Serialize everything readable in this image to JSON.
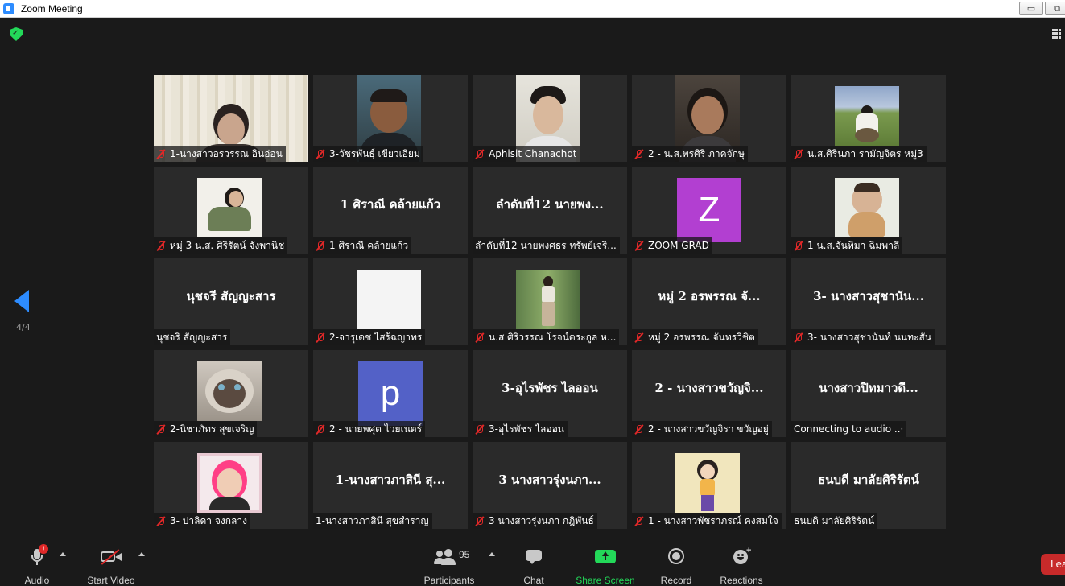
{
  "window": {
    "title": "Zoom Meeting",
    "minimize": "▭",
    "restore": "⧉"
  },
  "gallery": {
    "page_indicator": "4/4",
    "participants": [
      {
        "name": "1-นางสาวอรวรรณ อินอ่อน",
        "muted": true,
        "display": "video"
      },
      {
        "name": "3-วัชรพันธุ์ เขียวเอียม",
        "muted": true,
        "display": "video"
      },
      {
        "name": "Aphisit Chanachot",
        "muted": true,
        "display": "video"
      },
      {
        "name": "2 - น.ส.พรศิริ ภาคจักษุ",
        "muted": true,
        "display": "video"
      },
      {
        "name": "น.ส.ศิรินภา รามัญจิตร หมู่3",
        "muted": true,
        "display": "video"
      },
      {
        "name": "หมู่ 3 น.ส. ศิริรัตน์  จังพานิช",
        "muted": true,
        "display": "video"
      },
      {
        "name": "1 ศิราณี คล้ายแก้ว",
        "muted": true,
        "display": "name",
        "big": "1 ศิราณี คล้ายแก้ว"
      },
      {
        "name": "ลำดับที่12 นายพงศธร ทรัพย์เจริ...",
        "muted": false,
        "display": "name",
        "big": "ลำดับที่12 นายพง..."
      },
      {
        "name": "ZOOM GRAD",
        "muted": true,
        "display": "letter",
        "letter": "Z"
      },
      {
        "name": "1  น.ส.จันทิมา  ฉิมพาลี",
        "muted": true,
        "display": "video"
      },
      {
        "name": "นุชจริ สัญญะสาร",
        "muted": false,
        "display": "name",
        "big": "นุชจรี สัญญะสาร"
      },
      {
        "name": "2-จารุเดช ไสร้ฉญาทร",
        "muted": true,
        "display": "video"
      },
      {
        "name": "น.ส ศิริวรรณ โรจน์ตระกูล ห...",
        "muted": true,
        "display": "video"
      },
      {
        "name": "หมู่ 2 อรพรรณ จันทรวิชิต",
        "muted": true,
        "display": "name",
        "big": "หมู่ 2 อรพรรณ จั..."
      },
      {
        "name": "3- นางสาวสุชานันท์ นนทะสัน",
        "muted": true,
        "display": "name",
        "big": "3- นางสาวสุชานัน..."
      },
      {
        "name": "2-นิชาภัทร สุขเจริญ",
        "muted": true,
        "display": "video"
      },
      {
        "name": "2 - นายพศุต ไวยเนตร์",
        "muted": true,
        "display": "letter",
        "letter": "p"
      },
      {
        "name": "3-อุไรพัชร ไลออน",
        "muted": true,
        "display": "name",
        "big": "3-อุไรพัชร ไลออน"
      },
      {
        "name": "2 - นางสาวขวัญจิรา ขวัญอยู่",
        "muted": true,
        "display": "name",
        "big": "2 - นางสาวขวัญจิ..."
      },
      {
        "name": "Connecting to audio ..·",
        "muted": false,
        "display": "name",
        "big": "นางสาวปิทมาวดี..."
      },
      {
        "name": "3- ปาลิดา จงกลาง",
        "muted": true,
        "display": "video"
      },
      {
        "name": "1-นางสาวภาสินี สุขสำราญ",
        "muted": false,
        "display": "name",
        "big": "1-นางสาวภาสินี สุ..."
      },
      {
        "name": "3 นางสาวรุ่งนภา กฎิพันธ์",
        "muted": true,
        "display": "name",
        "big": "3 นางสาวรุ่งนภา..."
      },
      {
        "name": "1 - นางสาวพัชราภรณ์ คงสมใจ",
        "muted": true,
        "display": "video"
      },
      {
        "name": "ธนบดิ มาลัยศิริรัตน์",
        "muted": false,
        "display": "name",
        "big": "ธนบดี มาลัยศิริรัตน์"
      }
    ]
  },
  "toolbar": {
    "audio": "Audio",
    "audio_badge": "!",
    "start_video": "Start Video",
    "participants": "Participants",
    "participants_count": "95",
    "chat": "Chat",
    "share_screen": "Share Screen",
    "record": "Record",
    "reactions": "Reactions",
    "leave": "Lea"
  },
  "colors": {
    "accent": "#2d8cff",
    "share_green": "#23d959",
    "leave_red": "#c72a2a",
    "muted_red": "#e02828",
    "letter_purple": "#b23fd1",
    "letter_indigo": "#5361c7"
  }
}
